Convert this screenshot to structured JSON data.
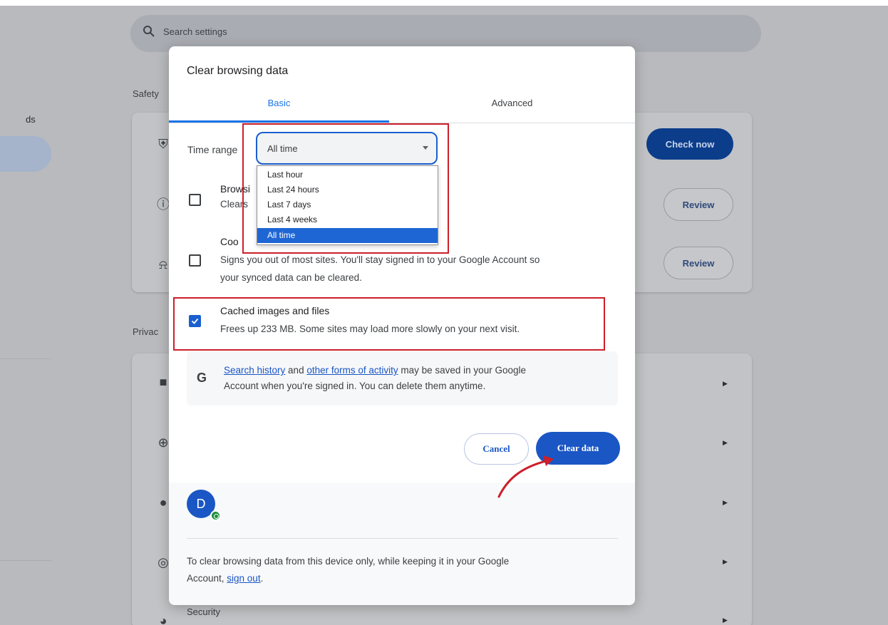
{
  "settings": {
    "search_placeholder": "Search settings",
    "sidebar_fragment": "ds",
    "safety_heading": "Safety",
    "privacy_heading": "Privac",
    "check_now_label": "Check now",
    "review_label": "Review",
    "security_label": "Security"
  },
  "dialog": {
    "title": "Clear browsing data",
    "tabs": [
      {
        "label": "Basic",
        "active": true
      },
      {
        "label": "Advanced",
        "active": false
      }
    ],
    "time_range": {
      "label": "Time range",
      "value": "All time",
      "options": [
        "Last hour",
        "Last 24 hours",
        "Last 7 days",
        "Last 4 weeks",
        "All time"
      ],
      "selected": "All time"
    },
    "options": [
      {
        "title": "Browsi",
        "desc": "Clears",
        "checked": false
      },
      {
        "title": "Coo",
        "desc_line1": "Signs you out of most sites. You'll stay signed in to your Google Account so",
        "desc_line2": "your synced data can be cleared.",
        "checked": false
      },
      {
        "title": "Cached images and files",
        "desc": "Frees up 233 MB. Some sites may load more slowly on your next visit.",
        "checked": true
      }
    ],
    "google_note": {
      "letter": "G",
      "link1": "Search history",
      "text1": " and ",
      "link2": "other forms of activity",
      "text2": " may be saved in your Google",
      "line2": "Account when you're signed in. You can delete them anytime."
    },
    "cancel_label": "Cancel",
    "clear_label": "Clear data",
    "avatar_letter": "D",
    "footer_text_line1": "To clear browsing data from this device only, while keeping it in your Google",
    "footer_text_prefix": "Account, ",
    "footer_link": "sign out",
    "footer_text_suffix": "."
  },
  "colors": {
    "accent": "#1a56c4",
    "annotation": "#cc1f2a",
    "overlay": "#b9babd"
  }
}
